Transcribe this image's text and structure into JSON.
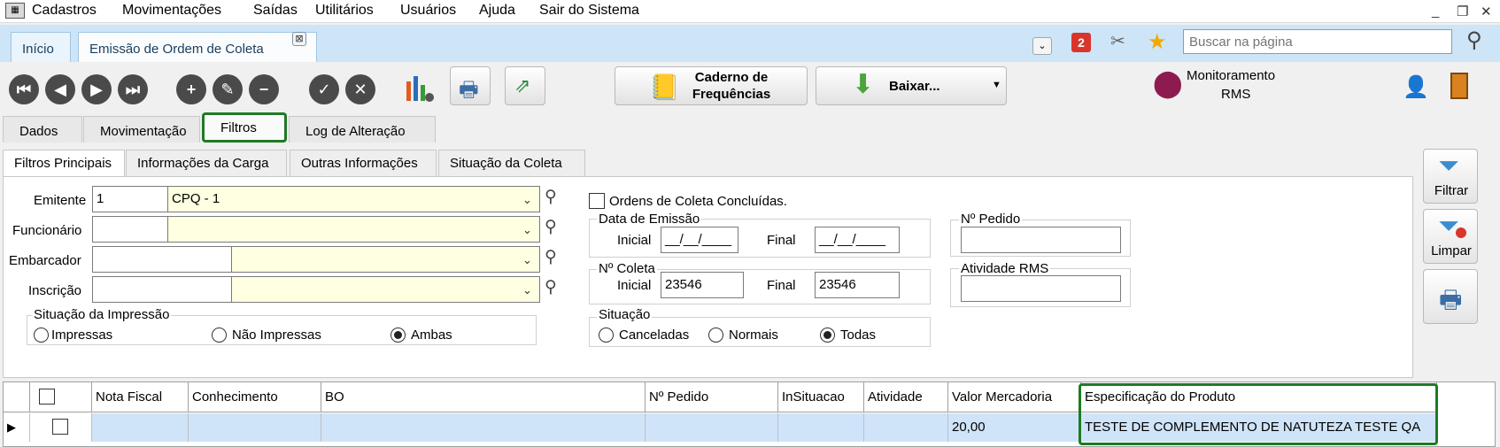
{
  "menu": [
    "Cadastros",
    "Movimentações",
    "Saídas",
    "Utilitários",
    "Usuários",
    "Ajuda",
    "Sair do Sistema"
  ],
  "tabs": {
    "home": "Início",
    "active": "Emissão de Ordem de Coleta"
  },
  "search": {
    "placeholder": "Buscar na página"
  },
  "toolbar": {
    "caderno_line1": "Caderno de",
    "caderno_line2": "Frequências",
    "baixar": "Baixar...",
    "monitor_line1": "Monitoramento",
    "monitor_line2": "RMS",
    "badge_count": "2"
  },
  "main_tabs": [
    "Dados",
    "Movimentação",
    "Filtros",
    "Log de Alteração"
  ],
  "sub_tabs": [
    "Filtros Principais",
    "Informações da Carga",
    "Outras Informações",
    "Situação da Coleta"
  ],
  "form": {
    "emitente_label": "Emitente",
    "emitente_code": "1",
    "emitente_name": "CPQ - 1",
    "funcionario_label": "Funcionário",
    "embarcador_label": "Embarcador",
    "inscricao_label": "Inscrição",
    "situacao_impressao": {
      "title": "Situação da Impressão",
      "options": [
        "Impressas",
        "Não Impressas",
        "Ambas"
      ],
      "selected": "Ambas"
    },
    "concluidas_label": "Ordens de Coleta Concluídas.",
    "data_emissao": {
      "title": "Data de Emissão",
      "inicial_label": "Inicial",
      "final_label": "Final",
      "inicial_value": "__/__/____",
      "final_value": "__/__/____"
    },
    "num_coleta": {
      "title": "Nº Coleta",
      "inicial_label": "Inicial",
      "final_label": "Final",
      "inicial_value": "23546",
      "final_value": "23546"
    },
    "situacao": {
      "title": "Situação",
      "options": [
        "Canceladas",
        "Normais",
        "Todas"
      ],
      "selected": "Todas"
    },
    "num_pedido_label": "Nº Pedido",
    "atividade_rms_label": "Atividade RMS"
  },
  "side_buttons": {
    "filtrar": "Filtrar",
    "limpar": "Limpar"
  },
  "grid": {
    "columns": [
      "Nota Fiscal",
      "Conhecimento",
      "BO",
      "Nº Pedido",
      "InSituacao",
      "Atividade",
      "Valor Mercadoria",
      "Especificação do Produto"
    ],
    "rows": [
      {
        "nota_fiscal": "",
        "conhecimento": "",
        "bo": "",
        "num_pedido": "",
        "insituacao": "",
        "atividade": "",
        "valor_mercadoria": "20,00",
        "especificacao": "TESTE DE COMPLEMENTO DE NATUTEZA TESTE QA"
      }
    ]
  },
  "colors": {
    "highlight": "#1e7a23",
    "selected_row": "#cfe4f8",
    "tab_bar": "#cde5f7",
    "required_field": "#ffffe1"
  }
}
